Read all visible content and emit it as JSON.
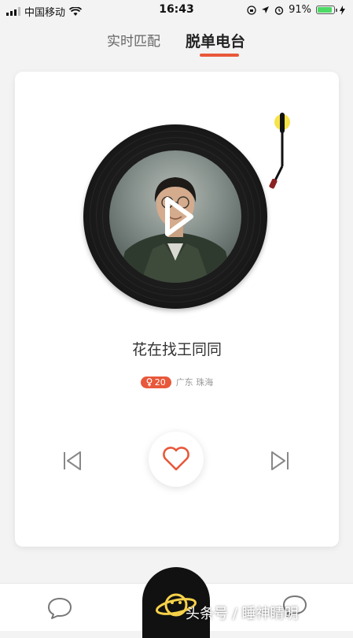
{
  "status_bar": {
    "carrier": "中国移动",
    "time": "16:43",
    "battery": "91%",
    "battery_level": 0.91
  },
  "tabs": [
    {
      "label": "实时匹配",
      "active": false
    },
    {
      "label": "脱单电台",
      "active": true
    }
  ],
  "card": {
    "name": "花在找王同同",
    "age_badge": "20",
    "location": "广东 珠海",
    "accent": "#e8583a"
  },
  "controls": {
    "prev_icon": "skip-previous-icon",
    "like_icon": "heart-icon",
    "next_icon": "skip-next-icon"
  },
  "bottom_nav": {
    "left_icon": "chat-bubble-icon",
    "center_icon": "planet-icon",
    "right_icon": "chat-bubble-icon"
  },
  "watermark": "头条号 / 睡神睛明"
}
